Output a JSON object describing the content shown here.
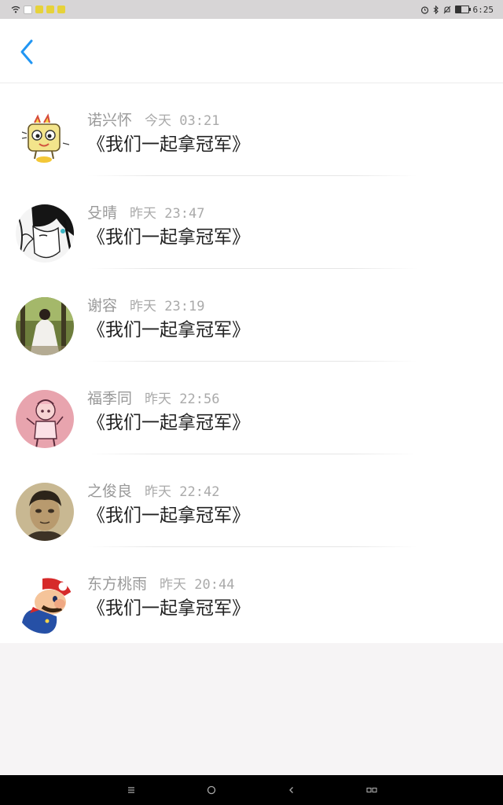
{
  "status_bar": {
    "time": "6:25",
    "icons": [
      "wifi-icon",
      "app-notification-icon",
      "alarm-icon",
      "bluetooth-icon",
      "mute-icon",
      "battery-icon"
    ]
  },
  "header": {
    "back_icon": "chevron-left-icon",
    "accent": "#2196f3"
  },
  "comments": [
    {
      "name": "诺兴怀",
      "time": "今天 03:21",
      "content": "《我们一起拿冠军》"
    },
    {
      "name": "殳晴",
      "time": "昨天 23:47",
      "content": "《我们一起拿冠军》"
    },
    {
      "name": "谢容",
      "time": "昨天 23:19",
      "content": "《我们一起拿冠军》"
    },
    {
      "name": "福季同",
      "time": "昨天 22:56",
      "content": "《我们一起拿冠军》"
    },
    {
      "name": "之俊良",
      "time": "昨天 22:42",
      "content": "《我们一起拿冠军》"
    },
    {
      "name": "东方桃雨",
      "time": "昨天 20:44",
      "content": "《我们一起拿冠军》"
    }
  ],
  "nav_bar": {
    "menu_icon": "menu-icon",
    "home_icon": "home-circle-icon",
    "back_icon": "back-triangle-icon",
    "recents_icon": "recents-icon"
  }
}
